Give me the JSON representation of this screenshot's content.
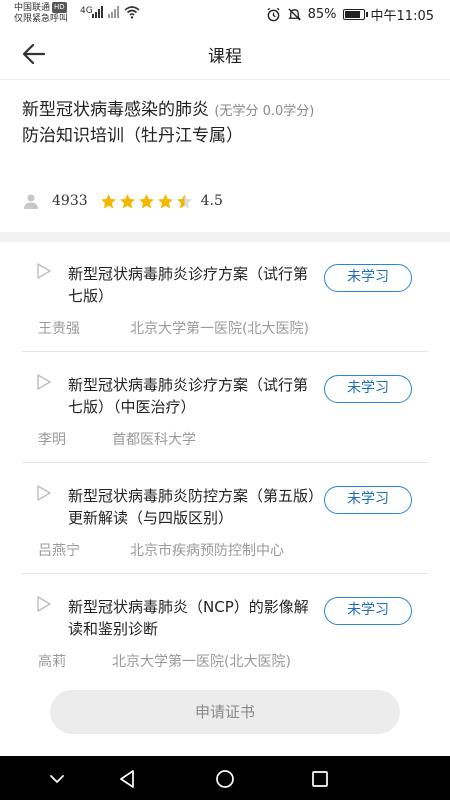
{
  "status_bar": {
    "carrier_line1": "中国联通",
    "carrier_hd": "HD",
    "carrier_line2": "仅限紧急呼叫",
    "network": "4G",
    "battery": "85%",
    "battery_level": 0.85,
    "time": "中午11:05"
  },
  "header": {
    "title": "课程",
    "back_icon": "arrow-left-icon"
  },
  "course": {
    "title": "新型冠状病毒感染的肺炎防治知识培训（牡丹江专属）",
    "credit": "(无学分 0.0学分)",
    "learners": "4933",
    "rating": "4.5",
    "rating_value": 4.5,
    "star_color": "#f5b700"
  },
  "lessons": [
    {
      "title": "新型冠状病毒肺炎诊疗方案（试行第七版）",
      "status": "未学习",
      "teacher": "王贵强",
      "org": "北京大学第一医院(北大医院)"
    },
    {
      "title": "新型冠状病毒肺炎诊疗方案（试行第七版）（中医治疗）",
      "status": "未学习",
      "teacher": "李明",
      "org": "首都医科大学"
    },
    {
      "title": "新型冠状病毒肺炎防控方案（第五版）更新解读（与四版区别）",
      "status": "未学习",
      "teacher": "吕燕宁",
      "org": "北京市疾病预防控制中心"
    },
    {
      "title": "新型冠状病毒肺炎（NCP）的影像解读和鉴别诊断",
      "status": "未学习",
      "teacher": "高莉",
      "org": "北京大学第一医院(北大医院)"
    }
  ],
  "apply_button": "申请证书",
  "accent_color": "#2a86d6"
}
